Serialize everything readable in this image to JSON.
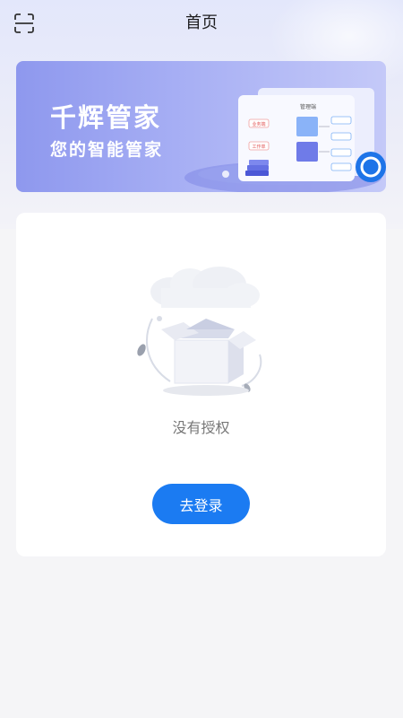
{
  "header": {
    "title": "首页",
    "scan_icon": "scan-icon"
  },
  "banner": {
    "title": "千辉管家",
    "subtitle": "您的智能管家",
    "illustration_texts": [
      "管理端",
      "业务端",
      "工作单"
    ]
  },
  "empty_state": {
    "message": "没有授权",
    "illustration": "empty-box-illustration"
  },
  "actions": {
    "login_label": "去登录"
  },
  "colors": {
    "primary": "#1b7bf2",
    "banner_start": "#8e98ee",
    "banner_end": "#c4c9f8",
    "page_bg": "#f5f5f7"
  }
}
